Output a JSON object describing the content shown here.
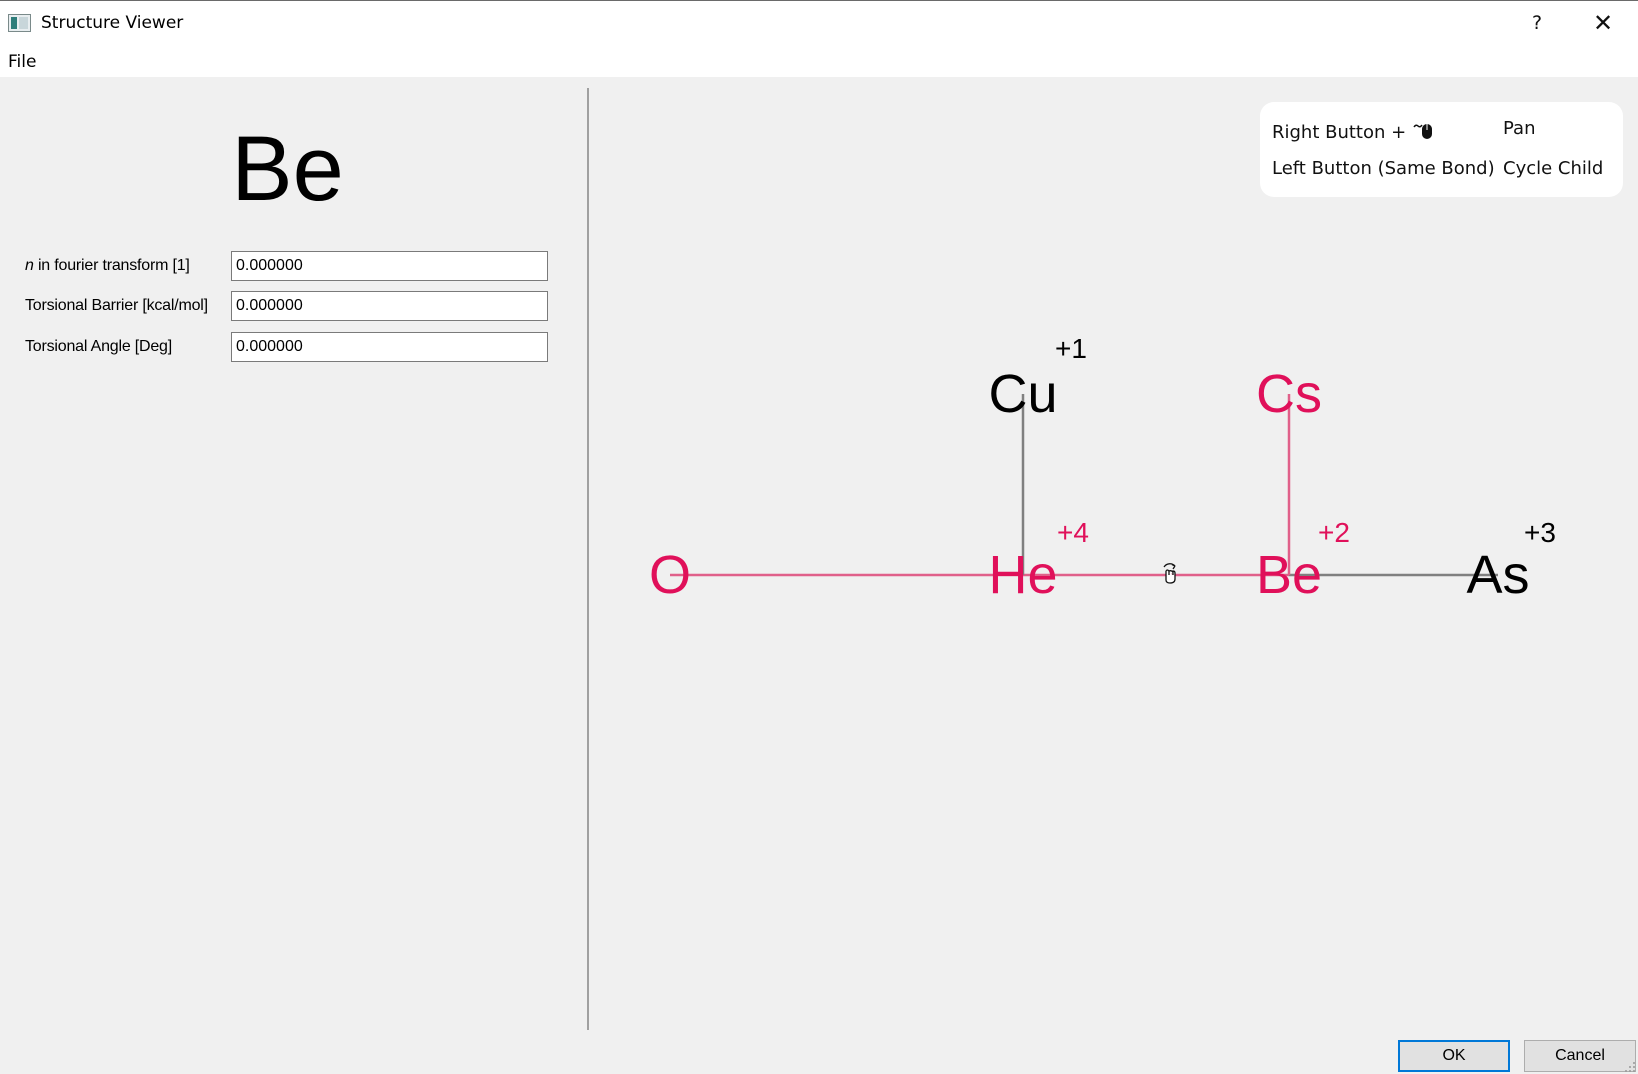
{
  "window": {
    "title": "Structure Viewer",
    "help_label": "?",
    "close_label": "✕"
  },
  "menu": {
    "file_label": "File"
  },
  "properties": {
    "element_symbol": "Be",
    "fields": [
      {
        "label_prefix": "n",
        "label": " in fourier transform [1]",
        "value": "0.000000"
      },
      {
        "label_prefix": "",
        "label": "Torsional Barrier [kcal/mol]",
        "value": "0.000000"
      },
      {
        "label_prefix": "",
        "label": "Torsional Angle [Deg]",
        "value": "0.000000"
      }
    ]
  },
  "legend": {
    "rows": [
      {
        "action": "Right Button + ",
        "icon": "mouse-drag-icon",
        "result": "Pan"
      },
      {
        "action": "Left Button (Same Bond)",
        "icon": "",
        "result": "Cycle Child"
      }
    ]
  },
  "molecule": {
    "highlight_color": "#e0105a",
    "normal_color": "#000000",
    "bond_normal_color": "#808080",
    "bond_highlight_color": "#e0608a",
    "atoms": [
      {
        "id": "O",
        "symbol": "O",
        "charge": "",
        "highlighted": true
      },
      {
        "id": "He",
        "symbol": "He",
        "charge": "+4",
        "highlighted": true
      },
      {
        "id": "Be",
        "symbol": "Be",
        "charge": "+2",
        "highlighted": true
      },
      {
        "id": "As",
        "symbol": "As",
        "charge": "+3",
        "highlighted": false
      },
      {
        "id": "Cu",
        "symbol": "Cu",
        "charge": "+1",
        "highlighted": false
      },
      {
        "id": "Cs",
        "symbol": "Cs",
        "charge": "",
        "highlighted": true
      }
    ],
    "bonds": [
      {
        "from": "O",
        "to": "He",
        "highlighted": true
      },
      {
        "from": "He",
        "to": "Be",
        "highlighted": true
      },
      {
        "from": "Be",
        "to": "As",
        "highlighted": false
      },
      {
        "from": "He",
        "to": "Cu",
        "highlighted": false
      },
      {
        "from": "Be",
        "to": "Cs",
        "highlighted": true
      }
    ],
    "rotation_cursor_icon": "rotate-cursor-icon"
  },
  "buttons": {
    "ok_label": "OK",
    "cancel_label": "Cancel"
  }
}
